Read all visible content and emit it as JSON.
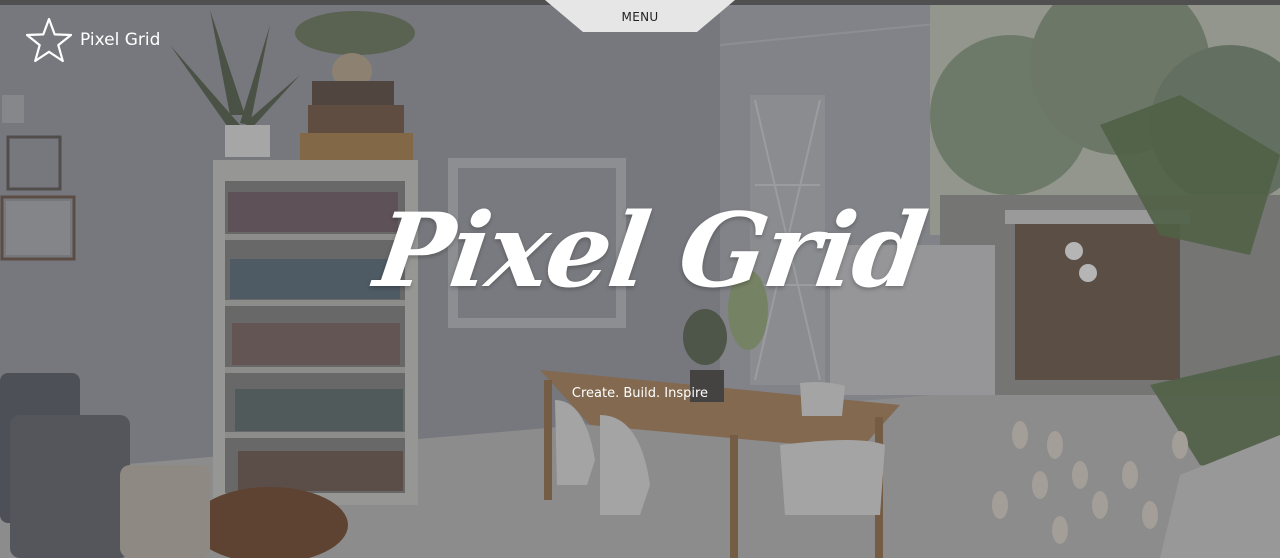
{
  "header": {
    "brand_name": "Pixel Grid",
    "brand_icon": "star-outline-icon",
    "menu_label": "MENU"
  },
  "hero": {
    "title": "Pixel Grid",
    "tagline": "Create. Build. Inspire",
    "background_image": "interior-room-photo"
  },
  "colors": {
    "text": "#ffffff",
    "menu_tab": "#e6e6e6",
    "top_bar": "#505050"
  }
}
